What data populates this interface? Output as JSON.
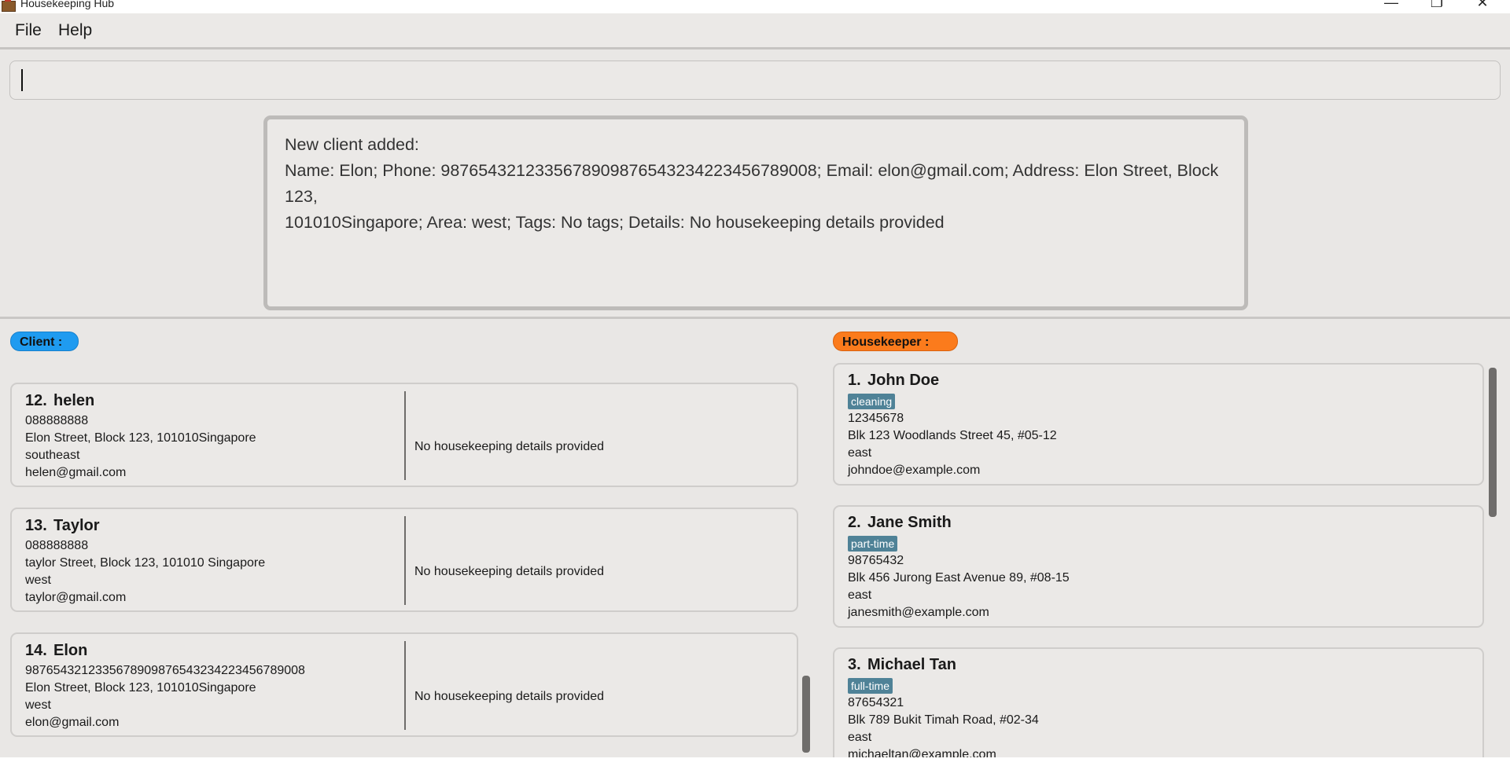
{
  "window": {
    "title": "Housekeeping Hub",
    "minimize_icon": "minimize-icon",
    "maximize_icon": "restore-icon",
    "close_icon": "close-icon"
  },
  "menu": {
    "file": "File",
    "help": "Help"
  },
  "command": {
    "value": ""
  },
  "result": {
    "text": "New client added:\nName: Elon; Phone: 98765432123356789098765432342234567890​08; Email: elon@gmail.com; Address: Elon Street, Block 123,\n101010Singapore; Area: west; Tags: No tags; Details: No housekeeping details provided"
  },
  "client_panel": {
    "label": "Client :",
    "color": "#1f9bf0",
    "cards": [
      {
        "index": "12.",
        "name": "helen",
        "phone": "088888888",
        "address": "Elon Street, Block 123, 101010Singapore",
        "area": "southeast",
        "email": "helen@gmail.com",
        "details": "No housekeeping details provided"
      },
      {
        "index": "13.",
        "name": "Taylor",
        "phone": "088888888",
        "address": "taylor Street, Block 123, 101010 Singapore",
        "area": "west",
        "email": "taylor@gmail.com",
        "details": "No housekeeping details provided"
      },
      {
        "index": "14.",
        "name": "Elon",
        "phone": "987654321233567890987654323422345678900​8",
        "address": "Elon Street, Block 123, 101010Singapore",
        "area": "west",
        "email": "elon@gmail.com",
        "details": "No housekeeping details provided"
      }
    ]
  },
  "housekeeper_panel": {
    "label": "Housekeeper :",
    "color": "#fb7b1c",
    "cards": [
      {
        "index": "1.",
        "name": "John Doe",
        "tag": "cleaning",
        "phone": "12345678",
        "address": "Blk 123 Woodlands Street 45, #05-12",
        "area": "east",
        "email": "johndoe@example.com"
      },
      {
        "index": "2.",
        "name": "Jane Smith",
        "tag": "part-time",
        "phone": "98765432",
        "address": "Blk 456 Jurong East Avenue 89, #08-15",
        "area": "east",
        "email": "janesmith@example.com"
      },
      {
        "index": "3.",
        "name": "Michael Tan",
        "tag": "full-time",
        "phone": "87654321",
        "address": "Blk 789 Bukit Timah Road, #02-34",
        "area": "east",
        "email": "michaeltan@example.com"
      }
    ]
  }
}
